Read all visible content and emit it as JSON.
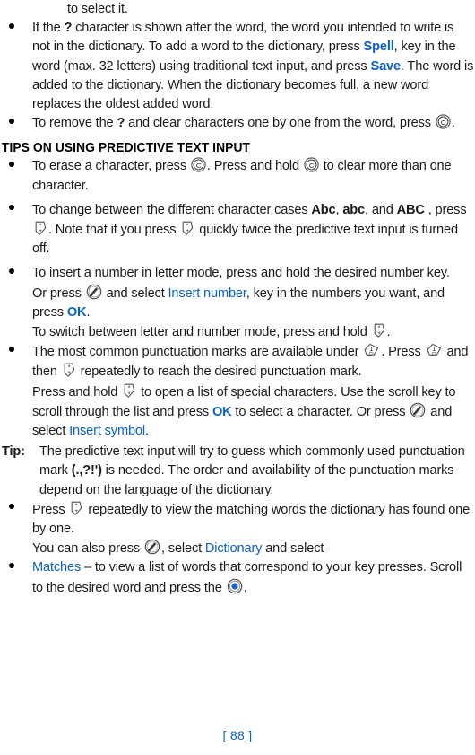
{
  "document": {
    "page_number_label": "[ 88 ]",
    "accent_color": "#0a62c4",
    "text_color": "#1a1a1a"
  },
  "blocks": {
    "intro_tail": {
      "text": "to select it."
    },
    "bullet_question_mark": {
      "part1": "If the ",
      "qmark": "?",
      "part2": " character is shown after the word, the word you intended to write is not in the dictionary. To add a word to the dictionary, press ",
      "link_spell": "Spell",
      "part3": ", key in the word (max. 32 letters) using traditional text input, and press ",
      "link_save": "Save",
      "part4": ". The word is added to the dictionary. When the dictionary becomes full, a new word replaces the oldest added word."
    },
    "bullet_remove_question": {
      "part1": "To remove the ",
      "qmark": "?",
      "part2": " and clear characters one by one from the word, press ",
      "key": "clear-key",
      "part3": "."
    },
    "heading_tips": {
      "text": "TIPS ON USING PREDICTIVE TEXT INPUT"
    },
    "bullet_erase": {
      "part1": "To erase a character, press ",
      "key1": "clear-key",
      "part2": ". Press and hold ",
      "key2": "clear-key",
      "part3": " to clear more than one character."
    },
    "bullet_cases": {
      "part1": "To change between the different character cases ",
      "case_abc_title": "Abc",
      "sep1": ", ",
      "case_abc_lower": "abc",
      "sep2": ", and ",
      "case_abc_upper": "ABC",
      "part2": " , press ",
      "key1": "asterisk-key",
      "part3": ". Note that if you press ",
      "key2": "asterisk-key",
      "part4": " quickly twice the predictive text input is turned off."
    },
    "bullet_insert_number": {
      "part1": "To insert a number in letter mode, press and hold the desired number key."
    },
    "cont_or_press": {
      "part1": "Or press ",
      "key": "edit-key",
      "part2": " and select ",
      "link_insert_number": "Insert number",
      "part3": ", key in the numbers you want, and press ",
      "link_ok": "OK",
      "part4": "."
    },
    "cont_switch_mode": {
      "part1": "To switch between letter and number mode, press and hold ",
      "key": "asterisk-key",
      "part2": "."
    },
    "bullet_punctuation": {
      "part1": "The most common punctuation marks are available under ",
      "key1": "one-key",
      "part2": ". Press ",
      "key2": "one-key",
      "part3": " and then ",
      "key3": "asterisk-key",
      "part4": " repeatedly to reach the desired punctuation mark."
    },
    "cont_special_chars": {
      "part1": "Press and hold ",
      "key1": "asterisk-key",
      "part2": " to open a list of special characters. Use the scroll key to scroll through the list and press ",
      "link_ok": "OK",
      "part3": " to select a character. Or press ",
      "key2": "edit-key",
      "part4": " and select ",
      "link_insert_symbol": "Insert symbol",
      "part5": "."
    },
    "tip_punctuation": {
      "label": "Tip:",
      "part1": "The predictive text input will try to guess which commonly used punctuation mark ",
      "marks": "(.,?!')",
      "part2": " is needed. The order and availability of the punctuation marks depend on the language of the dictionary."
    },
    "bullet_press_repeatedly": {
      "part1": "Press ",
      "key": "asterisk-key",
      "part2": " repeatedly to view the matching words the dictionary has found one by one."
    },
    "cont_you_can_also": {
      "part1": "You can also press ",
      "key": "edit-key",
      "part2": ", select ",
      "link_dictionary": "Dictionary",
      "part3": " and select"
    },
    "bullet_matches": {
      "link_matches": "Matches",
      "part1": " – to view a list of words that correspond to your key presses. Scroll to the desired word and press the ",
      "key": "scroll-key",
      "part2": "."
    }
  }
}
